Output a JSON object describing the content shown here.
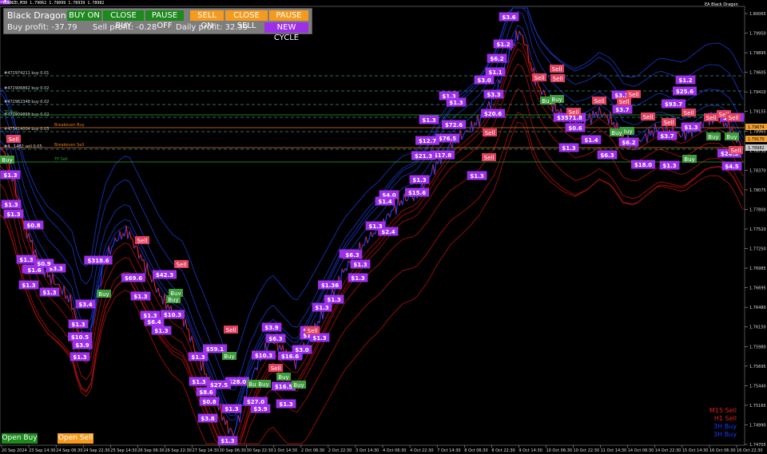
{
  "window": {
    "title": "EURNZD,M30  1.79062 1.79099 1.78939 1.78982",
    "expert_label": "EA Black Dragon"
  },
  "panel": {
    "title": "Black Dragon",
    "buy_on": "BUY ON",
    "close_buy": "CLOSE BUY",
    "pause_buy": "PAUSE OFF",
    "sell_on": "SELL ON",
    "close_sell": "CLOSE SELL",
    "pause_sell": "PAUSE OFF",
    "buy_profit": "Buy profit: -37.79",
    "sell_profit": "Sell profit: -0.28",
    "daily_profit": "Daily profit: 32.39",
    "new_cycle": "NEW CYCLE"
  },
  "buttons": {
    "open_buy": "Open Buy",
    "open_sell": "Open Sell"
  },
  "colors": {
    "panel": "#7d7d7d",
    "buy_green": "#1c8a1c",
    "sell_orange": "#f59a1c",
    "purple_label": "#9b30e8",
    "sell_tag": "#e04060",
    "buy_tag": "#3d9a3d",
    "price_red": "#e02020",
    "price_blue": "#1a3cff",
    "band_red": "#b01010",
    "band_blue": "#1a36c8"
  },
  "price_axis": {
    "ticks": [
      "1.80065",
      "1.79950",
      "1.79895",
      "1.79605",
      "1.79410",
      "1.79155",
      "1.78965",
      "1.78750",
      "1.78370",
      "1.78075",
      "1.77800",
      "1.77520",
      "1.77250",
      "1.76985",
      "1.76695",
      "1.76480",
      "1.76150",
      "1.75980",
      "1.75695",
      "1.75440",
      "1.75165",
      "1.74990",
      "1.74705"
    ],
    "current_tags": [
      "1.79674",
      "1.78982",
      "1.79170"
    ]
  },
  "time_axis": {
    "ticks": [
      "20 Sep 2024",
      "23 Sep 14:30",
      "24 Sep 06:30",
      "24 Sep 22:30",
      "25 Sep 14:30",
      "26 Sep 06:30",
      "26 Sep 22:30",
      "27 Sep 14:30",
      "30 Sep 06:30",
      "30 Sep 22:30",
      "1 Oct 14:30",
      "2 Oct 06:30",
      "2 Oct 22:30",
      "3 Oct 14:30",
      "4 Oct 06:30",
      "4 Oct 22:30",
      "7 Oct 14:30",
      "8 Oct 06:30",
      "8 Oct 22:30",
      "9 Oct 14:30",
      "10 Oct 06:30",
      "10 Oct 22:30",
      "11 Oct 14:30",
      "14 Oct 06:30",
      "14 Oct 22:30",
      "15 Oct 14:30",
      "16 Oct 06:30",
      "16 Oct 22:30"
    ]
  },
  "order_lines": [
    {
      "label": "#472974211 buy 0.01",
      "color": "#3a8f8f"
    },
    {
      "label": "#472906862 buy 0.02",
      "color": "#3a8f8f"
    },
    {
      "label": "#472962348 buy 0.02",
      "color": "#3a8f8f"
    },
    {
      "label": "#473909868 buy 0.02",
      "color": "#3a8f8f"
    },
    {
      "label": "TP Buy",
      "color": "#2aa02a"
    },
    {
      "label": "#473414004 buy 0.03",
      "color": "#3a8f8f"
    },
    {
      "label": "Breakeven Buy",
      "color": "#e07a1a"
    },
    {
      "label": "#4...1482 sell 0.05",
      "color": "#3a8f8f"
    },
    {
      "label": "Breakeven Sell",
      "color": "#e07a1a"
    },
    {
      "label": "TP Sell",
      "color": "#2aa02a"
    }
  ],
  "legend": [
    {
      "label": "M15 Sell",
      "color": "#e02020"
    },
    {
      "label": "H1 Sell",
      "color": "#e02020"
    },
    {
      "label": "3H Buy",
      "color": "#1a3cff"
    },
    {
      "label": "3H Buy",
      "color": "#1a3cff"
    }
  ],
  "profit_labels": [
    {
      "text": "$3.6"
    },
    {
      "text": "$1.2"
    },
    {
      "text": "$6.2"
    },
    {
      "text": "$1.1"
    },
    {
      "text": "$3.0"
    },
    {
      "text": "$3.3"
    },
    {
      "text": "$1.3"
    },
    {
      "text": "$20.6"
    },
    {
      "text": "$1.3"
    },
    {
      "text": "$1.3"
    },
    {
      "text": "$72.6"
    },
    {
      "text": "$76.5"
    },
    {
      "text": "$12.7"
    },
    {
      "text": "$17.8"
    },
    {
      "text": "$21.3"
    },
    {
      "text": "$1.3"
    },
    {
      "text": "$15.6"
    },
    {
      "text": "$4.0"
    },
    {
      "text": "$1.4"
    },
    {
      "text": "$2.4"
    },
    {
      "text": "$1.3"
    },
    {
      "text": "$6.3"
    },
    {
      "text": "$1.3"
    },
    {
      "text": "$1.3"
    },
    {
      "text": "$1.36"
    },
    {
      "text": "$1.3"
    },
    {
      "text": "$1.3"
    },
    {
      "text": "$3.0"
    },
    {
      "text": "$1.3"
    },
    {
      "text": "$1.3"
    },
    {
      "text": "$3.9"
    },
    {
      "text": "$6.3"
    },
    {
      "text": "$10.3"
    },
    {
      "text": "$16.6"
    },
    {
      "text": "$3.0"
    },
    {
      "text": "$16.5"
    },
    {
      "text": "$1.3"
    },
    {
      "text": "$27.0"
    },
    {
      "text": "$3.9"
    },
    {
      "text": "$28.0"
    },
    {
      "text": "$27.5"
    },
    {
      "text": "$8.6"
    },
    {
      "text": "$0.8"
    },
    {
      "text": "$3.8"
    },
    {
      "text": "$1.3"
    },
    {
      "text": "$1.3"
    },
    {
      "text": "$59.1"
    },
    {
      "text": "$1.3"
    },
    {
      "text": "$1.3"
    },
    {
      "text": "$10.3"
    },
    {
      "text": "$6.4"
    },
    {
      "text": "$1.3"
    },
    {
      "text": "$42.3"
    },
    {
      "text": "$69.6"
    },
    {
      "text": "$1.3"
    },
    {
      "text": "$1.3"
    },
    {
      "text": "$318.6"
    },
    {
      "text": "$3.4"
    },
    {
      "text": "$1.3"
    },
    {
      "text": "$10.5"
    },
    {
      "text": "$3.9"
    },
    {
      "text": "$1.3"
    },
    {
      "text": "$1.3"
    },
    {
      "text": "$1.6"
    },
    {
      "text": "$3.3"
    },
    {
      "text": "$0.9"
    },
    {
      "text": "$1.3"
    },
    {
      "text": "$0.8"
    },
    {
      "text": "$1.3"
    },
    {
      "text": "$1.3"
    },
    {
      "text": "$1.3"
    },
    {
      "text": "$1.3"
    },
    {
      "text": "$1.3"
    },
    {
      "text": "$6.3"
    },
    {
      "text": "$1.3"
    },
    {
      "text": "$3571.8"
    },
    {
      "text": "$0.6"
    },
    {
      "text": "$3.7"
    },
    {
      "text": "$3.3"
    },
    {
      "text": "$93.7"
    },
    {
      "text": "$1.3"
    },
    {
      "text": "$1.4"
    },
    {
      "text": "$6.3"
    },
    {
      "text": "$6.2"
    },
    {
      "text": "$18.0"
    },
    {
      "text": "$1.3"
    },
    {
      "text": "$3.7"
    },
    {
      "text": "$1.3"
    },
    {
      "text": "$25.6"
    },
    {
      "text": "$21.3"
    },
    {
      "text": "$20.3"
    },
    {
      "text": "$4.5"
    },
    {
      "text": "$1.2"
    },
    {
      "text": "$1.3"
    }
  ],
  "sell_tags": [
    {
      "text": "Sell"
    },
    {
      "text": "Sell"
    },
    {
      "text": "Sell"
    },
    {
      "text": "Sell"
    },
    {
      "text": "Sell"
    },
    {
      "text": "Sell"
    },
    {
      "text": "Sell"
    },
    {
      "text": "Sell"
    },
    {
      "text": "Sell"
    },
    {
      "text": "Sell"
    },
    {
      "text": "Sell"
    },
    {
      "text": "Sell"
    },
    {
      "text": "Sell"
    },
    {
      "text": "Sell"
    },
    {
      "text": "Sell"
    },
    {
      "text": "Sell"
    },
    {
      "text": "Sell"
    },
    {
      "text": "Sell"
    },
    {
      "text": "Sell"
    },
    {
      "text": "Sell"
    },
    {
      "text": "Sell"
    },
    {
      "text": "Sell"
    }
  ],
  "buy_tags": [
    {
      "text": "Buy"
    },
    {
      "text": "Buy"
    },
    {
      "text": "Buy"
    },
    {
      "text": "Buy"
    },
    {
      "text": "Buy"
    },
    {
      "text": "Buy"
    },
    {
      "text": "Buy"
    },
    {
      "text": "Buy"
    },
    {
      "text": "Buy"
    },
    {
      "text": "Buy"
    },
    {
      "text": "Buy"
    },
    {
      "text": "Buy"
    },
    {
      "text": "Buy"
    },
    {
      "text": "Buy"
    },
    {
      "text": "Buy"
    },
    {
      "text": "Buy"
    }
  ]
}
